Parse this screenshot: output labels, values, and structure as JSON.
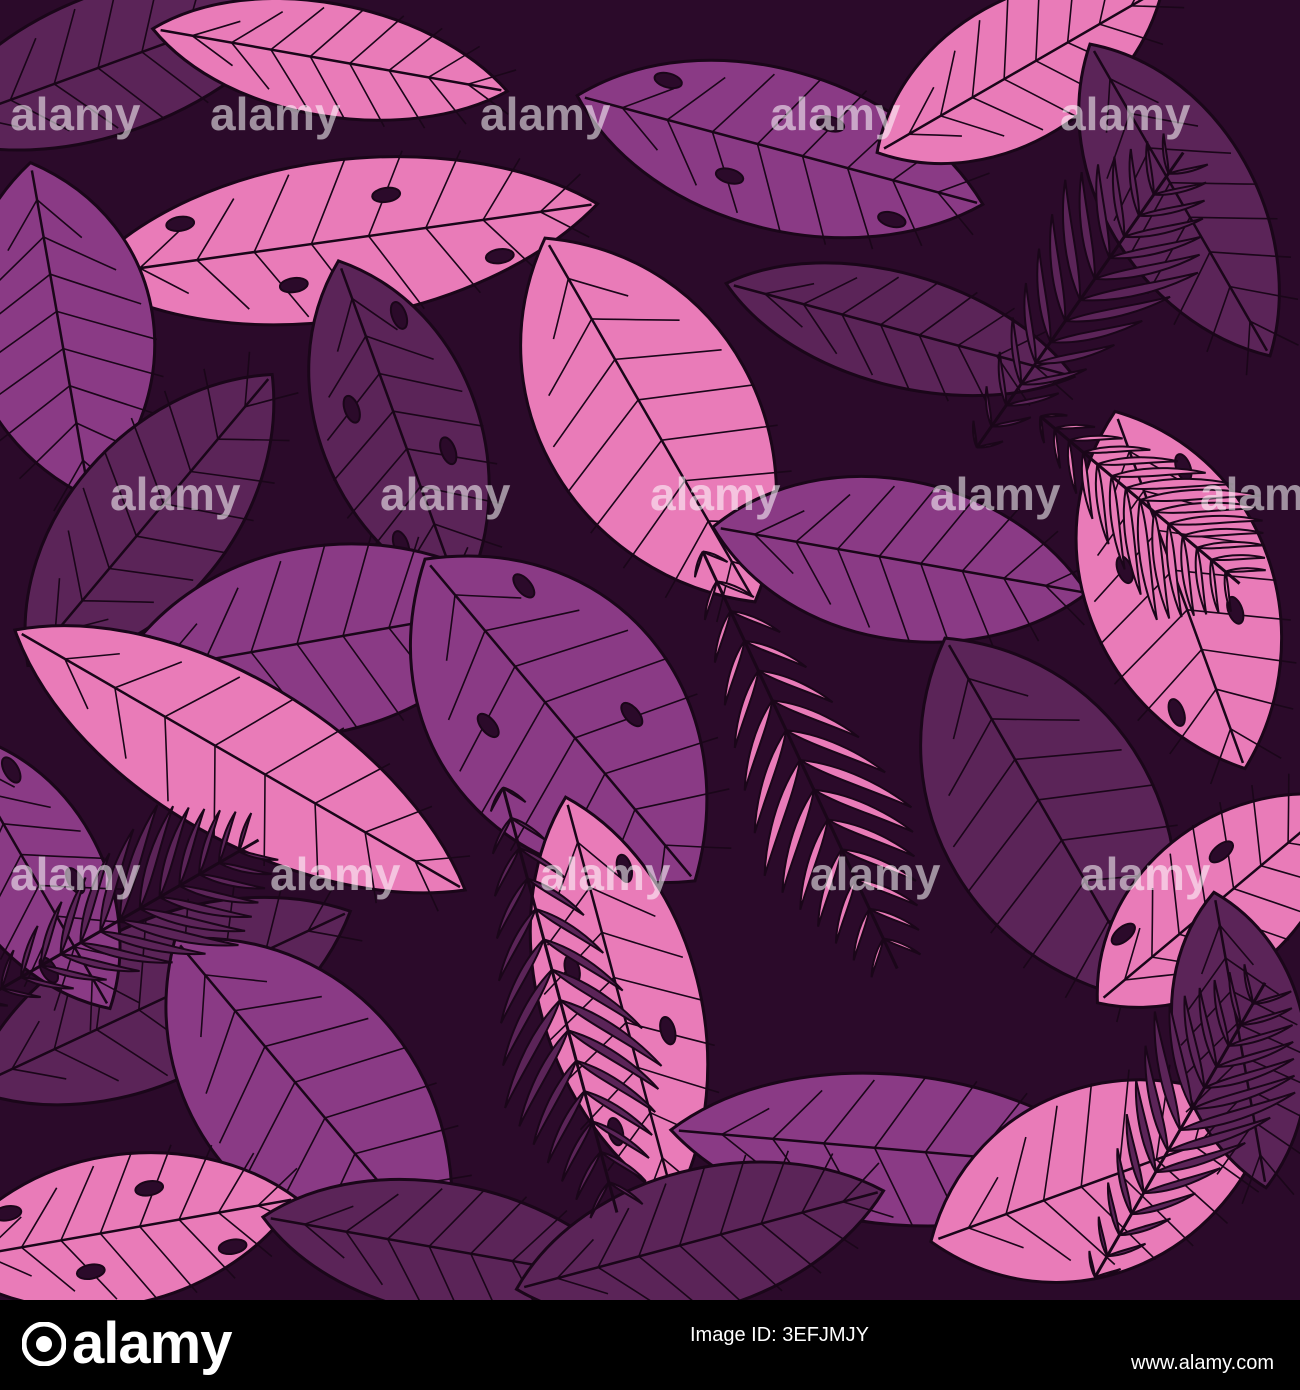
{
  "image": {
    "subject": "tropical leaves pattern",
    "colors": {
      "background": "#2b0a2a",
      "dark": "#5b2458",
      "mid": "#8a3a85",
      "light": "#e97bb8",
      "outline": "#1a0619"
    }
  },
  "watermark": {
    "text": "alamy"
  },
  "footer": {
    "brand": "alamy",
    "image_id": "Image ID: 3EFJMJY",
    "url": "www.alamy.com"
  }
}
